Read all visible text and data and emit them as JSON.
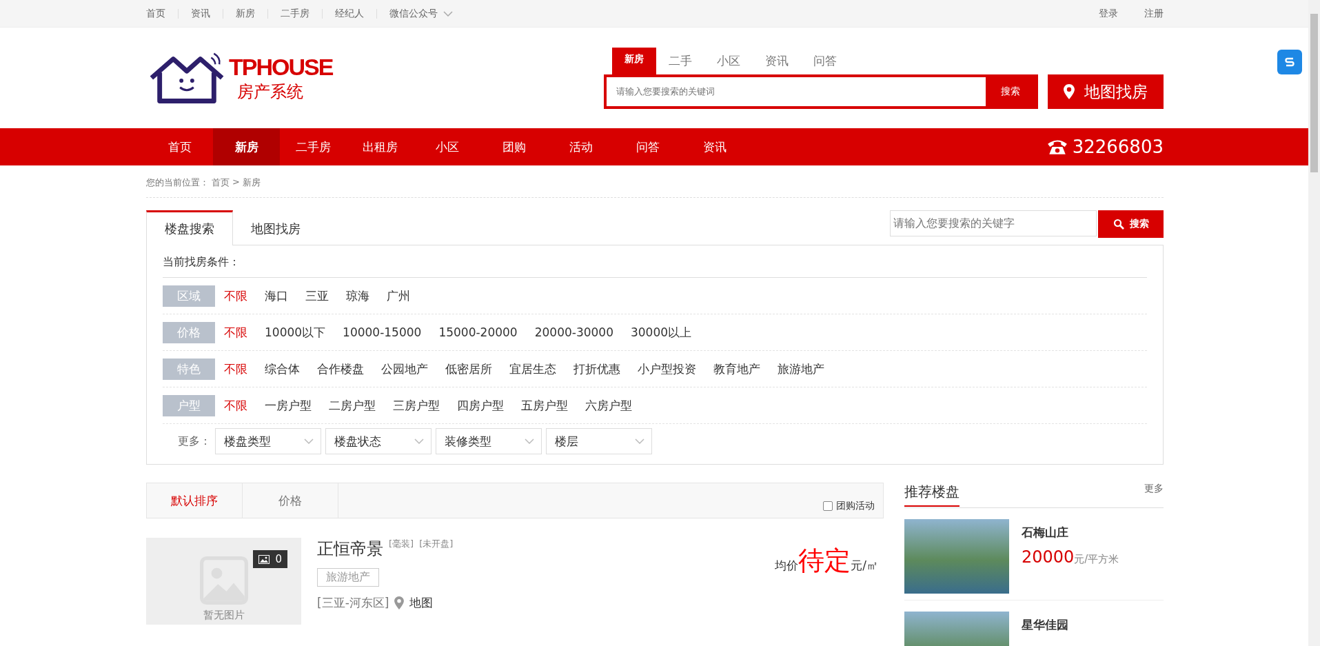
{
  "top_bar": {
    "links": [
      "首页",
      "资讯",
      "新房",
      "二手房",
      "经纪人",
      "微信公众号"
    ],
    "account": [
      "登录",
      "注册"
    ]
  },
  "header": {
    "logo": {
      "title": "TPHOUSE",
      "subtitle": "房产系统"
    },
    "search_tabs": [
      {
        "label": "新房",
        "selected": true
      },
      {
        "label": "二手",
        "selected": false
      },
      {
        "label": "小区",
        "selected": false
      },
      {
        "label": "资讯",
        "selected": false
      },
      {
        "label": "问答",
        "selected": false
      }
    ],
    "search": {
      "placeholder": "请输入您要搜索的关键词",
      "button": "搜索"
    },
    "map_button": "地图找房"
  },
  "nav": {
    "items": [
      {
        "label": "首页",
        "selected": false
      },
      {
        "label": "新房",
        "selected": true
      },
      {
        "label": "二手房",
        "selected": false
      },
      {
        "label": "出租房",
        "selected": false
      },
      {
        "label": "小区",
        "selected": false
      },
      {
        "label": "团购",
        "selected": false
      },
      {
        "label": "活动",
        "selected": false
      },
      {
        "label": "问答",
        "selected": false
      },
      {
        "label": "资讯",
        "selected": false
      }
    ],
    "phone": "32266803"
  },
  "breadcrumb": {
    "prefix": "您的当前位置：",
    "items": [
      "首页",
      "新房"
    ],
    "separator": ">"
  },
  "search_panel": {
    "tabs": [
      {
        "label": "楼盘搜索",
        "selected": true
      },
      {
        "label": "地图找房",
        "selected": false
      }
    ],
    "search": {
      "placeholder": "请输入您要搜索的关键字",
      "button": "搜索"
    },
    "conditions_label": "当前找房条件：",
    "filters": [
      {
        "label": "区域",
        "options": [
          {
            "label": "不限",
            "selected": true
          },
          {
            "label": "海口",
            "selected": false
          },
          {
            "label": "三亚",
            "selected": false
          },
          {
            "label": "琼海",
            "selected": false
          },
          {
            "label": "广州",
            "selected": false
          }
        ]
      },
      {
        "label": "价格",
        "options": [
          {
            "label": "不限",
            "selected": true
          },
          {
            "label": "10000以下",
            "selected": false
          },
          {
            "label": "10000-15000",
            "selected": false
          },
          {
            "label": "15000-20000",
            "selected": false
          },
          {
            "label": "20000-30000",
            "selected": false
          },
          {
            "label": "30000以上",
            "selected": false
          }
        ]
      },
      {
        "label": "特色",
        "options": [
          {
            "label": "不限",
            "selected": true
          },
          {
            "label": "综合体",
            "selected": false
          },
          {
            "label": "合作楼盘",
            "selected": false
          },
          {
            "label": "公园地产",
            "selected": false
          },
          {
            "label": "低密居所",
            "selected": false
          },
          {
            "label": "宜居生态",
            "selected": false
          },
          {
            "label": "打折优惠",
            "selected": false
          },
          {
            "label": "小户型投资",
            "selected": false
          },
          {
            "label": "教育地产",
            "selected": false
          },
          {
            "label": "旅游地产",
            "selected": false
          }
        ]
      },
      {
        "label": "户型",
        "options": [
          {
            "label": "不限",
            "selected": true
          },
          {
            "label": "一房户型",
            "selected": false
          },
          {
            "label": "二房户型",
            "selected": false
          },
          {
            "label": "三房户型",
            "selected": false
          },
          {
            "label": "四房户型",
            "selected": false
          },
          {
            "label": "五房户型",
            "selected": false
          },
          {
            "label": "六房户型",
            "selected": false
          }
        ]
      }
    ],
    "more_label": "更多：",
    "dropdowns": [
      "楼盘类型",
      "楼盘状态",
      "装修类型",
      "楼层"
    ]
  },
  "sort_bar": {
    "options": [
      {
        "label": "默认排序",
        "selected": true
      },
      {
        "label": "价格",
        "selected": false
      }
    ],
    "group_buy": {
      "label": "团购活动",
      "checked": false
    }
  },
  "listings": [
    {
      "title": "正恒帝景",
      "tags": [
        "[毫装]",
        "[未开盘]"
      ],
      "feature": "旅游地产",
      "photo_count": "0",
      "no_photo": "暂无图片",
      "location": "[三亚-河东区]",
      "map_link": "地图",
      "price_label": "均价",
      "price": "待定",
      "price_unit": "元/㎡"
    }
  ],
  "recommended": {
    "title": "推荐楼盘",
    "more": "更多",
    "items": [
      {
        "name": "石梅山庄",
        "price": "20000",
        "unit": "元/平方米"
      },
      {
        "name": "星华佳园"
      }
    ]
  }
}
